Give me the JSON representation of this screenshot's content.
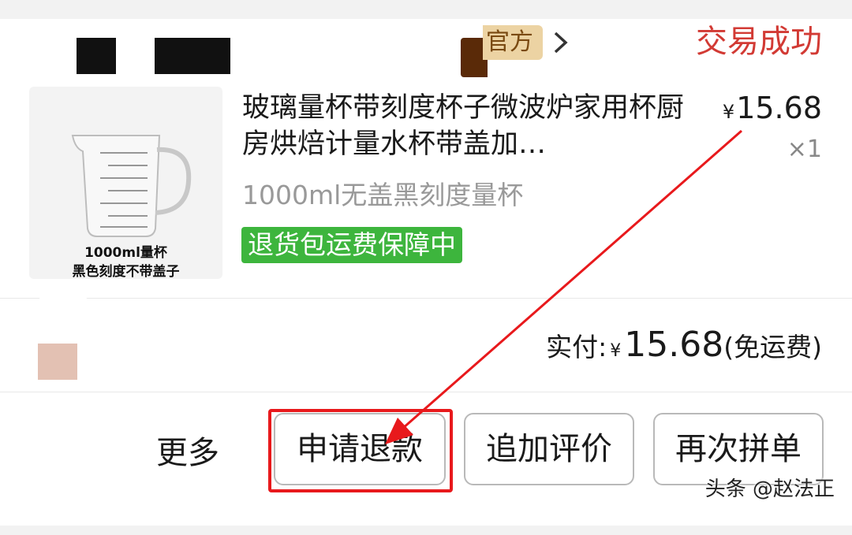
{
  "store": {
    "tag": "官方",
    "status": "交易成功"
  },
  "product": {
    "image_caption_line1": "1000ml量杯",
    "image_caption_line2": "黑色刻度不带盖子",
    "title": "玻璃量杯带刻度杯子微波炉家用杯厨房烘焙计量水杯带盖加…",
    "price_symbol": "¥",
    "price": "15.68",
    "quantity": "×1",
    "spec": "1000ml无盖黑刻度量杯",
    "badge": "退货包运费保障中"
  },
  "summary": {
    "label": "实付:",
    "currency": "¥",
    "amount": "15.68",
    "note": "(免运费)"
  },
  "actions": {
    "more": "更多",
    "refund": "申请退款",
    "add_review": "追加评价",
    "reorder": "再次拼单"
  },
  "watermark": "头条 @赵法正",
  "colors": {
    "status": "#d23a34",
    "badge_bg": "#3db53d",
    "highlight": "#e8191c",
    "tag_bg": "#ecd3a3"
  },
  "icons": {
    "store_chevron": "chevron-right-icon",
    "annotation_arrow": "red-arrow-annotation"
  }
}
